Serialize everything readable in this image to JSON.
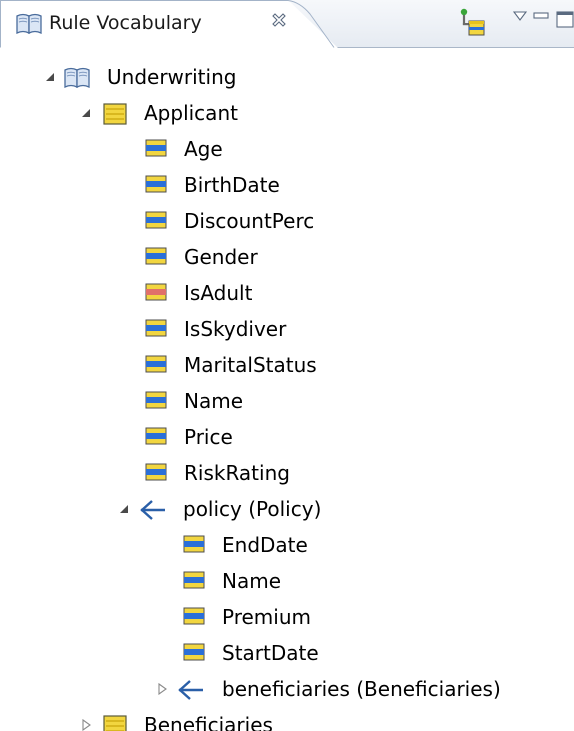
{
  "view": {
    "title": "Rule Vocabulary"
  },
  "tree": {
    "root": {
      "label": "Underwriting"
    },
    "applicant": {
      "label": "Applicant",
      "attributes": [
        {
          "label": "Age"
        },
        {
          "label": "BirthDate"
        },
        {
          "label": "DiscountPerc"
        },
        {
          "label": "Gender"
        },
        {
          "label": "IsAdult"
        },
        {
          "label": "IsSkydiver"
        },
        {
          "label": "MaritalStatus"
        },
        {
          "label": "Name"
        },
        {
          "label": "Price"
        },
        {
          "label": "RiskRating"
        }
      ]
    },
    "policy": {
      "label": "policy (Policy)",
      "attributes": [
        {
          "label": "EndDate"
        },
        {
          "label": "Name"
        },
        {
          "label": "Premium"
        },
        {
          "label": "StartDate"
        }
      ],
      "beneficiaries": {
        "label": "beneficiaries (Beneficiaries)"
      }
    },
    "beneficiaries_entity": {
      "label": "Beneficiaries"
    }
  },
  "colors": {
    "attribute_icon": "#2b6fd8",
    "derived_attribute_icon": "#e0706a",
    "entity_icon": "#f2d640",
    "association_icon": "#2a5fa8"
  }
}
